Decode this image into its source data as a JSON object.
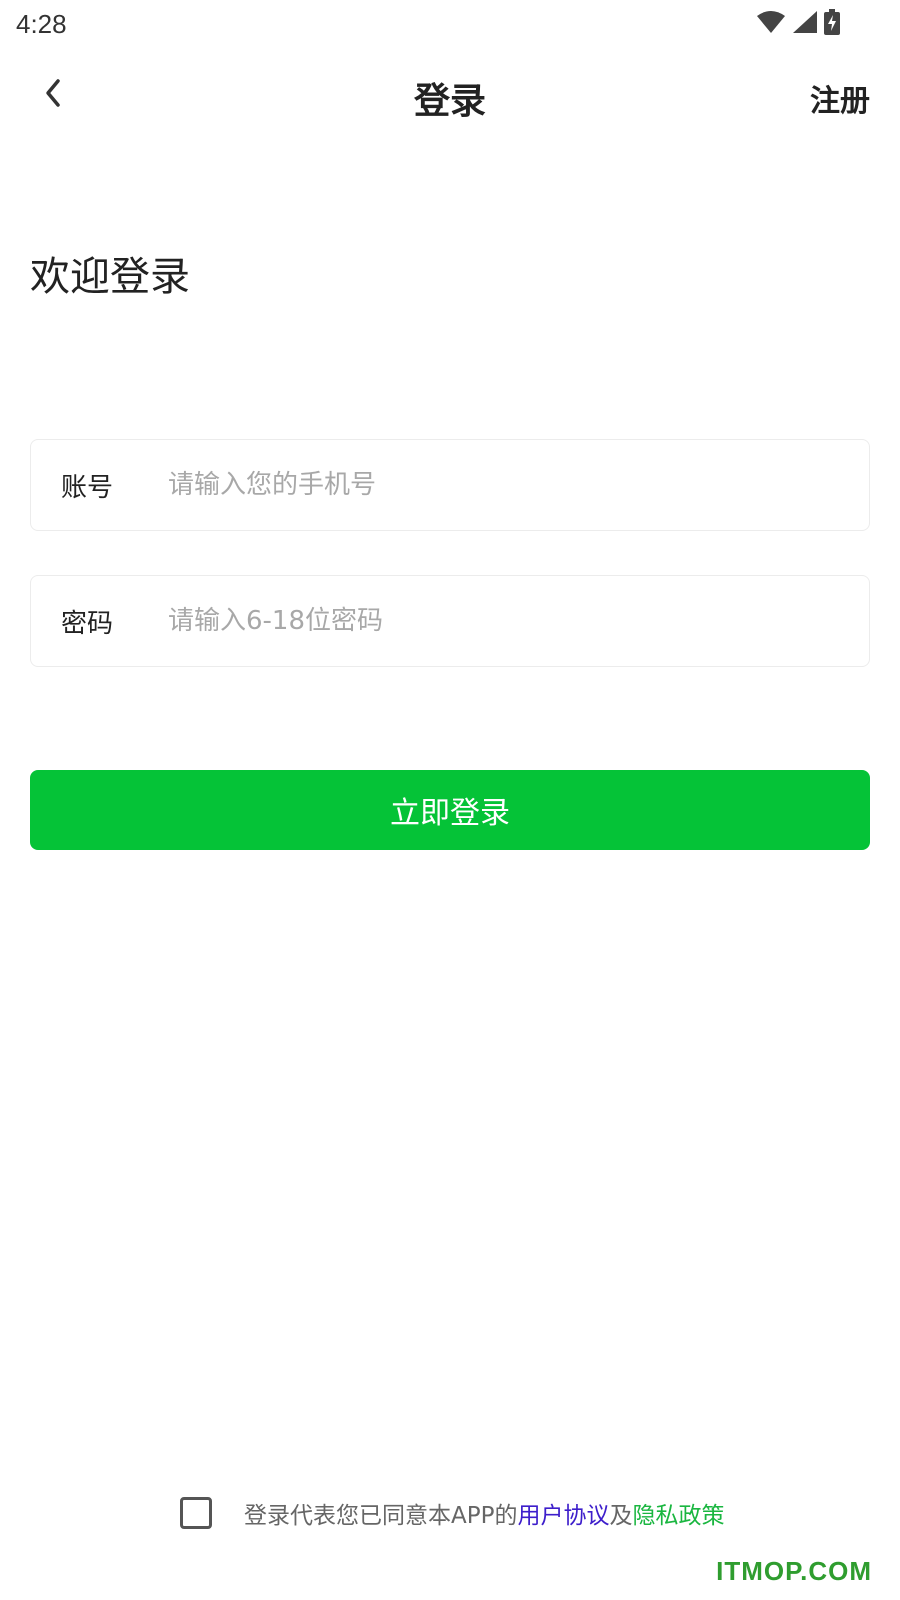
{
  "status_bar": {
    "time": "4:28",
    "icons": [
      "wifi-icon",
      "signal-icon",
      "battery-charging-icon"
    ]
  },
  "header": {
    "back_icon": "chevron-left-icon",
    "title": "登录",
    "register_label": "注册"
  },
  "welcome": {
    "text": "欢迎登录"
  },
  "form": {
    "account": {
      "label": "账号",
      "value": "",
      "placeholder": "请输入您的手机号"
    },
    "password": {
      "label": "密码",
      "value": "",
      "placeholder": "请输入6-18位密码"
    },
    "submit_label": "立即登录"
  },
  "agreement": {
    "checked": false,
    "prefix": "登录代表您已同意本APP的",
    "user_agreement": "用户协议",
    "conjunction": "及",
    "privacy_policy": "隐私政策"
  },
  "watermark": "ITMOP.COM",
  "colors": {
    "primary_green": "#05c337",
    "user_link": "#3d1ecb",
    "privacy_link": "#1ab640",
    "placeholder": "#a8a8a8",
    "watermark": "#2f9d2f"
  }
}
